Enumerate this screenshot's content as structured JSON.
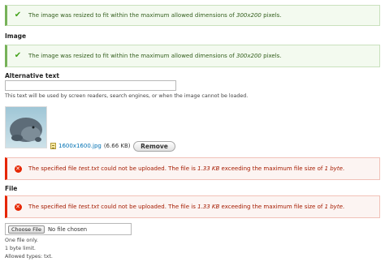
{
  "messages": {
    "resize_top": {
      "pre": "The image was resized to fit within the maximum allowed dimensions of ",
      "dims": "300x200",
      "post": " pixels."
    },
    "resize_image": {
      "pre": "The image was resized to fit within the maximum allowed dimensions of ",
      "dims": "300x200",
      "post": " pixels."
    },
    "upload_error_1": {
      "pre": "The specified file ",
      "filename": "test.txt",
      "mid": " could not be uploaded. The file is ",
      "size": "1.33 KB",
      "mid2": " exceeding the maximum file size of ",
      "limit": "1 byte",
      "post": "."
    },
    "upload_error_2": {
      "pre": "The specified file ",
      "filename": "test.txt",
      "mid": " could not be uploaded. The file is ",
      "size": "1.33 KB",
      "mid2": " exceeding the maximum file size of ",
      "limit": "1 byte",
      "post": "."
    }
  },
  "image_field": {
    "label": "Image",
    "alt_label": "Alternative text",
    "alt_value": "",
    "alt_description": "This text will be used by screen readers, search engines, or when the image cannot be loaded.",
    "file_link": "1600x1600.jpg",
    "file_size": "(6.66 KB)",
    "remove_label": "Remove"
  },
  "file_field": {
    "label": "File",
    "choose_label": "Choose File",
    "no_file_text": "No file chosen",
    "desc_lines": [
      "One file only.",
      "1 byte limit.",
      "Allowed types: txt."
    ]
  },
  "colors": {
    "status_bg": "#f3faef",
    "status_accent": "#77b259",
    "error_bg": "#fcf4f2",
    "error_accent": "#e62600",
    "link": "#0071b3"
  },
  "icons": {
    "status": "check-icon",
    "error": "error-icon",
    "file": "image-file-icon"
  }
}
